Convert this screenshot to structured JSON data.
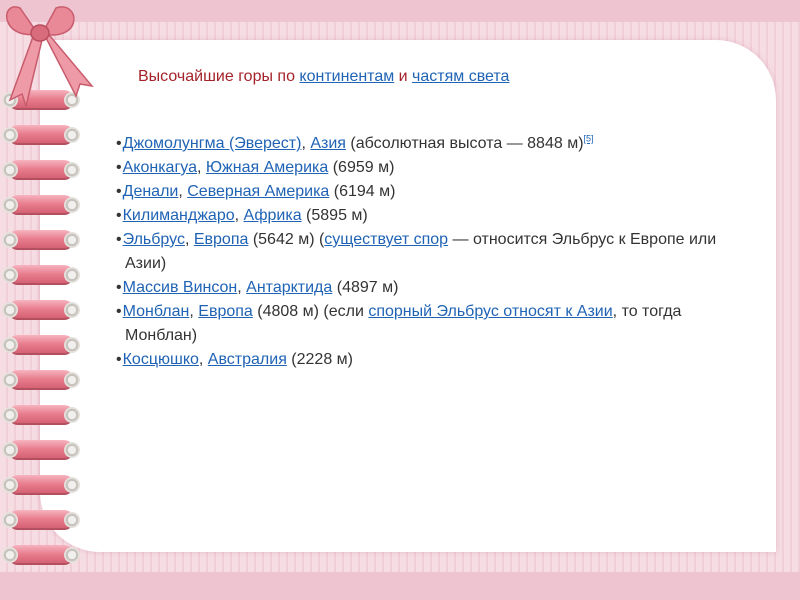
{
  "colors": {
    "title": "#a4232a",
    "link": "#1f63b5",
    "text": "#333333",
    "ribbon": "#e87d8e"
  },
  "title": {
    "before": "Высочайшие горы по ",
    "link1": "континентам",
    "middle": " и ",
    "link2": "частям света"
  },
  "items": [
    {
      "a": "Джомолунгма (Эверест)",
      "s1": ", ",
      "b": "Азия",
      "s2": " (абсолютная высота — 8848 м)",
      "sup": "[5]"
    },
    {
      "a": "Аконкагуа",
      "s1": ", ",
      "b": "Южная Америка",
      "s2": " (6959 м)"
    },
    {
      "a": "Денали",
      "s1": ", ",
      "b": "Северная Америка",
      "s2": " (6194 м)"
    },
    {
      "a": "Килиманджаро",
      "s1": ", ",
      "b": "Африка",
      "s2": " (5895 м)"
    },
    {
      "a": "Эльбрус",
      "s1": ", ",
      "b": "Европа",
      "s2": " (5642 м) (",
      "c": "существует спор",
      "s3": " — относится Эльбрус к Европе или Азии)"
    },
    {
      "a": "Массив Винсон",
      "s1": ", ",
      "b": "Антарктида",
      "s2": " (4897 м)"
    },
    {
      "a": "Монблан",
      "s1": ", ",
      "b": "Европа",
      "s2": " (4808 м) (если ",
      "c": "спорный Эльбрус относят к Азии",
      "s3": ", то тогда Монблан)"
    },
    {
      "a": "Косцюшко",
      "s1": ", ",
      "b": "Австралия",
      "s2": " (2228 м)"
    }
  ]
}
